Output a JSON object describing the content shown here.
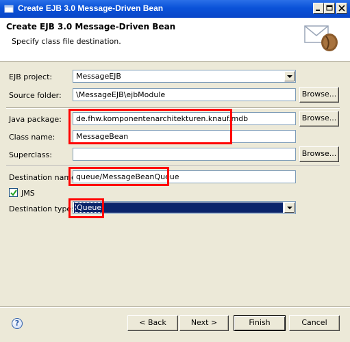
{
  "window": {
    "title": "Create EJB 3.0 Message-Driven Bean"
  },
  "header": {
    "title": "Create EJB 3.0 Message-Driven Bean",
    "description": "Specify class file destination.",
    "icon": "envelope-bean-icon"
  },
  "form": {
    "ejb_project": {
      "label": "EJB project:",
      "value": "MessageEJB"
    },
    "source_folder": {
      "label": "Source folder:",
      "value": "\\MessageEJB\\ejbModule",
      "browse": "Browse..."
    },
    "java_package": {
      "label": "Java package:",
      "value": "de.fhw.komponentenarchitekturen.knauf.mdb",
      "browse": "Browse..."
    },
    "class_name": {
      "label": "Class name:",
      "value": "MessageBean"
    },
    "superclass": {
      "label": "Superclass:",
      "value": "",
      "browse": "Browse..."
    },
    "destination_name": {
      "label": "Destination name:",
      "value": "queue/MessageBeanQueue"
    },
    "jms": {
      "label": "JMS",
      "checked": true
    },
    "destination_type": {
      "label": "Destination type:",
      "value": "Queue"
    }
  },
  "footer": {
    "help": "?",
    "back": "< Back",
    "next": "Next >",
    "finish": "Finish",
    "cancel": "Cancel"
  },
  "colors": {
    "highlight": "#ff0000",
    "title_bar": "#0a52d8",
    "selection": "#0a246a"
  }
}
